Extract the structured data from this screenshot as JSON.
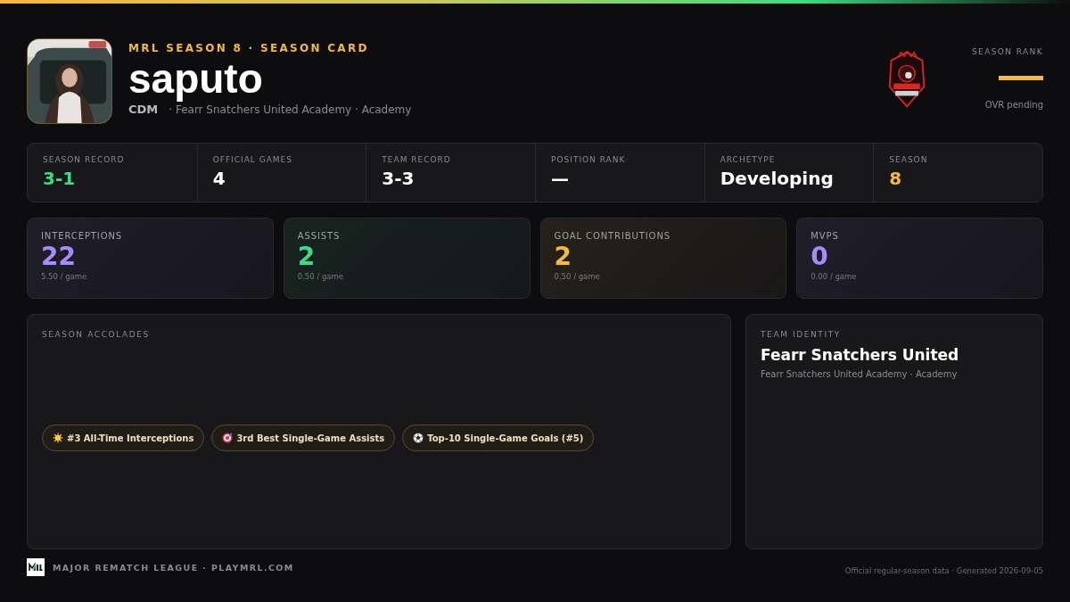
{
  "header": {
    "eyebrow": "MRL SEASON 8 · SEASON CARD",
    "player_name": "saputo",
    "position": "CDM",
    "team_line": "· Fearr Snatchers United Academy · Academy",
    "season_rank": {
      "label": "SEASON RANK",
      "note": "OVR pending"
    }
  },
  "summary": [
    {
      "label": "SEASON RECORD",
      "value": "3-1",
      "color": "#3ddc84"
    },
    {
      "label": "OFFICIAL GAMES",
      "value": "4",
      "color": "#ffffff"
    },
    {
      "label": "TEAM RECORD",
      "value": "3-3",
      "color": "#ffffff"
    },
    {
      "label": "POSITION RANK",
      "value": "—",
      "color": "#ffffff"
    },
    {
      "label": "ARCHETYPE",
      "value": "Developing",
      "color": "#ffffff"
    },
    {
      "label": "SEASON",
      "value": "8",
      "color": "#f5b83d"
    }
  ],
  "stats": [
    {
      "label": "INTERCEPTIONS",
      "value": "22",
      "per_game": "5.50 / game",
      "color": "#a78bfa"
    },
    {
      "label": "ASSISTS",
      "value": "2",
      "per_game": "0.50 / game",
      "color": "#3ddc84"
    },
    {
      "label": "GOAL CONTRIBUTIONS",
      "value": "2",
      "per_game": "0.50 / game",
      "color": "#f5b83d"
    },
    {
      "label": "MVPS",
      "value": "0",
      "per_game": "0.00 / game",
      "color": "#a78bfa"
    }
  ],
  "accolades": {
    "title": "SEASON ACCOLADES",
    "items": [
      {
        "kind": "sun",
        "label": "#3 All-Time Interceptions"
      },
      {
        "kind": "target",
        "label": "3rd Best Single-Game Assists"
      },
      {
        "kind": "ball",
        "label": "Top-10 Single-Game Goals (#5)"
      }
    ]
  },
  "team_identity": {
    "title": "TEAM IDENTITY",
    "team_name": "Fearr Snatchers United",
    "subtitle": "Fearr Snatchers United Academy · Academy"
  },
  "footer": {
    "brand": "MAJOR REMATCH LEAGUE · PLAYMRL.COM",
    "note": "Official regular-season data · Generated 2026-09-05"
  }
}
